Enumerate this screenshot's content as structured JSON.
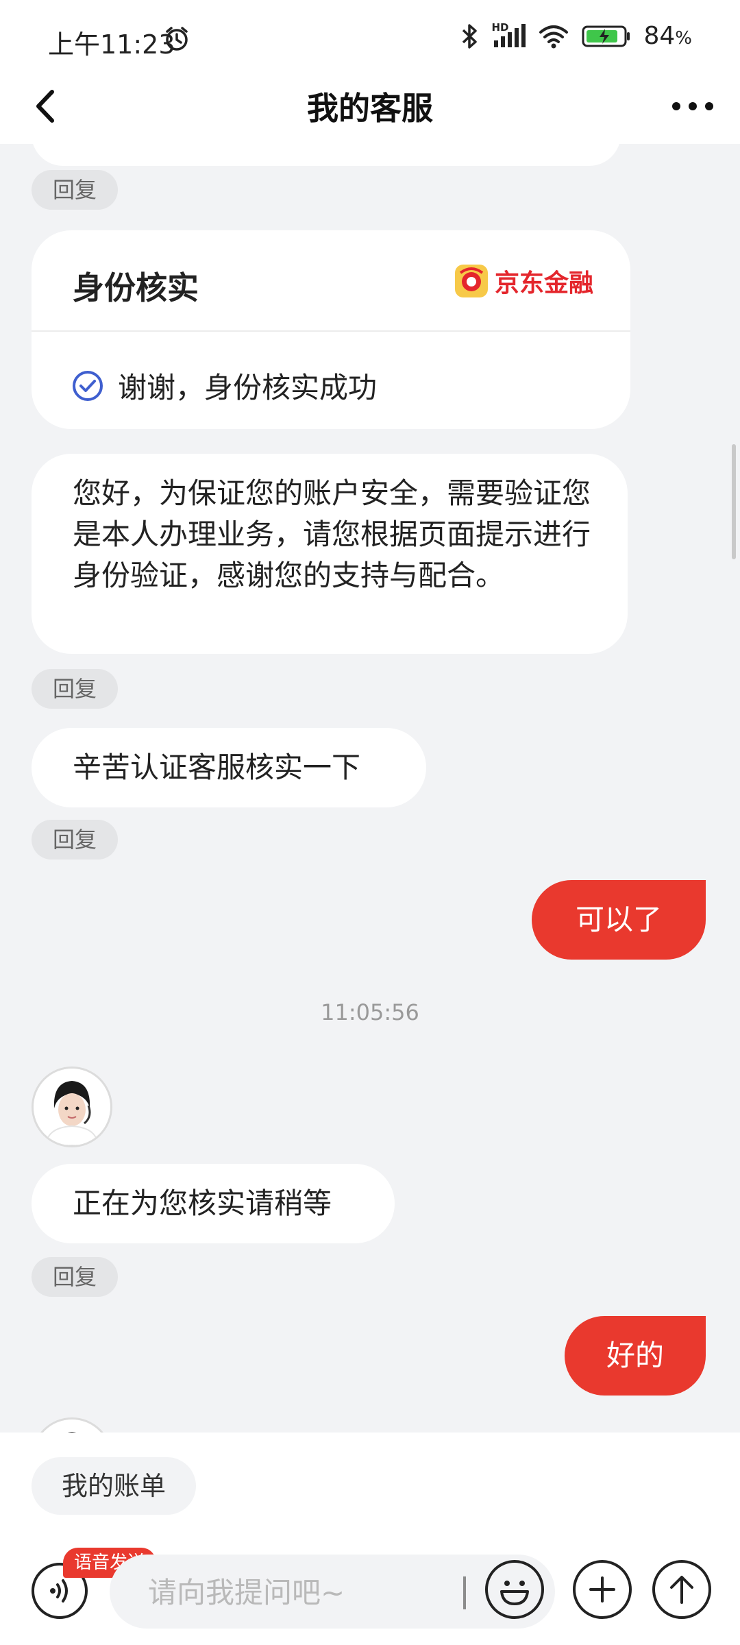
{
  "status_bar": {
    "time": "上午11:23",
    "battery": "84",
    "battery_unit": "%",
    "network": "HD"
  },
  "header": {
    "title": "我的客服"
  },
  "messages": {
    "reply_label": "回复",
    "verify_card": {
      "title": "身份核实",
      "brand": "京东金融",
      "status": "谢谢，身份核实成功"
    },
    "agent_msg_1": "您好，为保证您的账户安全，需要验证您是本人办理业务，请您根据页面提示进行身份验证，感谢您的支持与配合。",
    "agent_msg_2": "辛苦认证客服核实一下",
    "user_msg_1": "可以了",
    "timestamp": "11:05:56",
    "agent_msg_3": "正在为您核实请稍等",
    "user_msg_2": "好的"
  },
  "bottom": {
    "quick_reply": "我的账单",
    "voice_badge": "语音发送",
    "input_placeholder": "请向我提问吧~"
  },
  "colors": {
    "accent": "#e9392e",
    "background": "#f2f3f5",
    "brand_red": "#e4262c",
    "verified_blue": "#3f5fcf"
  }
}
